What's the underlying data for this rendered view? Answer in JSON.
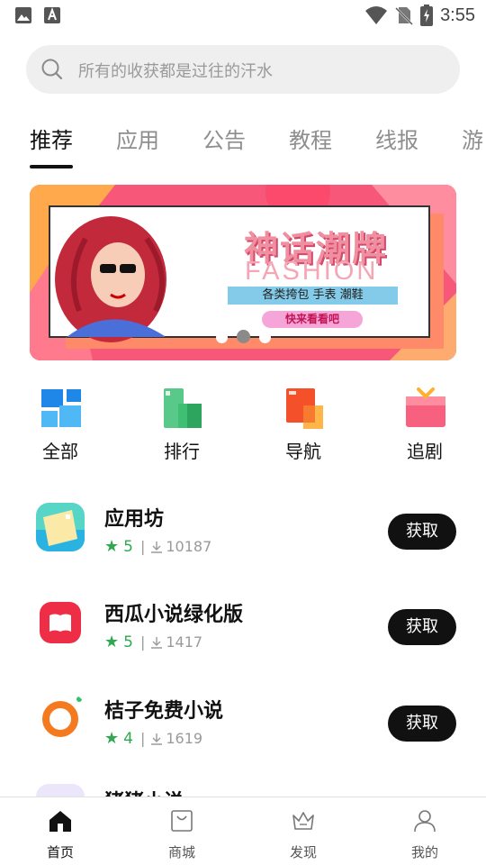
{
  "status_bar": {
    "time": "3:55",
    "icons": [
      "image-icon",
      "font-icon",
      "wifi-icon",
      "no-sim-icon",
      "battery-charging-icon"
    ]
  },
  "search": {
    "placeholder": "所有的收获都是过往的汗水",
    "icon": "search-icon"
  },
  "tabs": [
    {
      "label": "推荐",
      "active": true
    },
    {
      "label": "应用",
      "active": false
    },
    {
      "label": "公告",
      "active": false
    },
    {
      "label": "教程",
      "active": false
    },
    {
      "label": "线报",
      "active": false
    },
    {
      "label": "游",
      "active": false
    }
  ],
  "banner": {
    "title": "神话潮牌",
    "subtitle": "FASHION",
    "tagline": "各类挎包 手表 潮鞋",
    "cta": "快来看看吧",
    "page_count": 3,
    "active_page": 2
  },
  "quick_menu": [
    {
      "label": "全部",
      "icon": "grid-all-icon",
      "color": "#2f9df4"
    },
    {
      "label": "排行",
      "icon": "ranking-icon",
      "color": "#3fbf74"
    },
    {
      "label": "导航",
      "icon": "navigation-icon",
      "color": "#f45a2e"
    },
    {
      "label": "追剧",
      "icon": "tv-drama-icon",
      "color": "#f7607e"
    }
  ],
  "apps": [
    {
      "name": "应用坊",
      "rating": "5",
      "downloads": "10187",
      "button": "获取",
      "icon": "app-workshop-icon"
    },
    {
      "name": "西瓜小说绿化版",
      "rating": "5",
      "downloads": "1417",
      "button": "获取",
      "icon": "book-icon"
    },
    {
      "name": "桔子免费小说",
      "rating": "4",
      "downloads": "1619",
      "button": "获取",
      "icon": "orange-ring-icon"
    },
    {
      "name": "猪猪小说",
      "rating": "",
      "downloads": "",
      "button": "",
      "icon": "pig-icon"
    }
  ],
  "bottom_nav": [
    {
      "label": "首页",
      "icon": "home-icon",
      "active": true
    },
    {
      "label": "商城",
      "icon": "shopping-bag-icon",
      "active": false
    },
    {
      "label": "发现",
      "icon": "crown-icon",
      "active": false
    },
    {
      "label": "我的",
      "icon": "user-icon",
      "active": false
    }
  ],
  "colors": {
    "accent": "#111111",
    "rating_green": "#2fa84f",
    "banner_pink": "#f7587a"
  }
}
